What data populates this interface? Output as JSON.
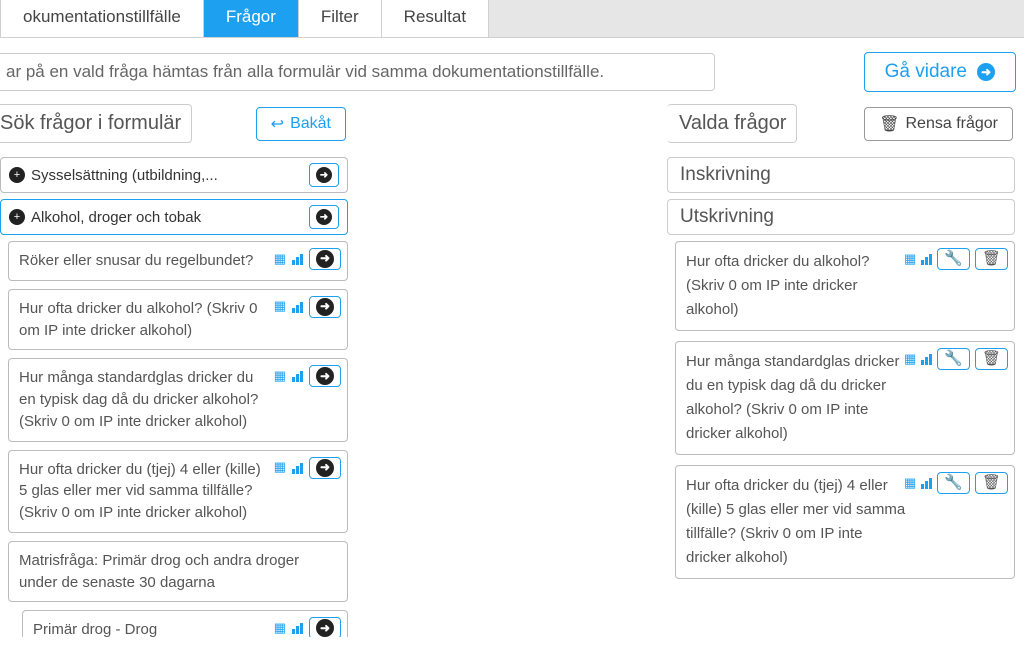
{
  "tabs": [
    "okumentationstillfälle",
    "Frågor",
    "Filter",
    "Resultat"
  ],
  "active_tab": 1,
  "info_text": "ar på en vald fråga hämtas från alla formulär vid samma dokumentationstillfälle.",
  "go_next": "Gå vidare",
  "left": {
    "title": "Sök frågor i formulär",
    "back": "Bakåt",
    "cats": [
      {
        "label": "Sysselsättning (utbildning,...",
        "active": false
      },
      {
        "label": "Alkohol, droger och tobak",
        "active": true
      }
    ],
    "questions": [
      {
        "text": "Röker eller snusar du regelbundet?",
        "add": true,
        "icons": true
      },
      {
        "text": "Hur ofta dricker du alkohol? (Skriv 0 om IP inte dricker alkohol)",
        "add": true,
        "icons": true
      },
      {
        "text": "Hur många standardglas dricker du en typisk dag då du dricker alkohol? (Skriv 0 om IP inte dricker alkohol)",
        "add": true,
        "icons": true
      },
      {
        "text": "Hur ofta dricker du (tjej) 4 eller (kille) 5 glas eller mer vid samma tillfälle? (Skriv 0 om IP inte dricker alkohol)",
        "add": true,
        "icons": true
      },
      {
        "text": "Matrisfråga: Primär drog och andra droger under de senaste 30 dagarna",
        "add": false,
        "icons": false
      },
      {
        "text": "Primär drog - Drog",
        "add": true,
        "icons": true,
        "child": true
      }
    ]
  },
  "right": {
    "title": "Valda frågor",
    "clear": "Rensa frågor",
    "sections": [
      {
        "title": "Inskrivning",
        "items": []
      },
      {
        "title": "Utskrivning",
        "items": [
          {
            "text": "Hur ofta dricker du alkohol? (Skriv 0 om IP inte dricker alkohol)"
          },
          {
            "text": "Hur många standardglas dricker du en typisk dag då du dricker alkohol? (Skriv 0 om IP inte dricker alkohol)"
          },
          {
            "text": "Hur ofta dricker du (tjej) 4 eller (kille) 5 glas eller mer vid samma tillfälle? (Skriv 0 om IP inte dricker alkohol)"
          }
        ]
      }
    ]
  }
}
